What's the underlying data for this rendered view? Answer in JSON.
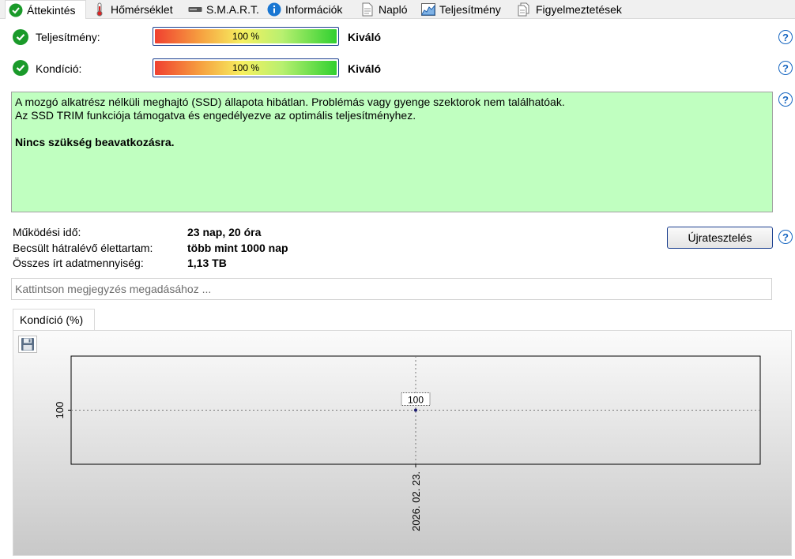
{
  "tabs": [
    {
      "label": "Áttekintés",
      "icon": "check-circle-icon",
      "active": true
    },
    {
      "label": "Hőmérséklet",
      "icon": "thermometer-icon",
      "active": false
    },
    {
      "label": "S.M.A.R.T.",
      "icon": "drive-icon",
      "active": false
    },
    {
      "label": "Információk",
      "icon": "info-icon",
      "active": false
    },
    {
      "label": "Napló",
      "icon": "document-icon",
      "active": false
    },
    {
      "label": "Teljesítmény",
      "icon": "performance-chart-icon",
      "active": false
    },
    {
      "label": "Figyelmeztetések",
      "icon": "warnings-icon",
      "active": false
    }
  ],
  "performance": {
    "label": "Teljesítmény:",
    "value": 1.0,
    "percent_text": "100 %",
    "rating": "Kiváló"
  },
  "condition": {
    "label": "Kondíció:",
    "value": 1.0,
    "percent_text": "100 %",
    "rating": "Kiváló"
  },
  "info": {
    "line1": "A mozgó alkatrész nélküli meghajtó (SSD) állapota hibátlan. Problémás vagy gyenge szektorok nem találhatóak.",
    "line2": "Az SSD TRIM funkciója támogatva és engedélyezve az optimális teljesítményhez.",
    "line3": "Nincs szükség beavatkozásra."
  },
  "stats": {
    "uptime_label": "Működési idő:",
    "uptime_value": "23 nap, 20 óra",
    "lifetime_label": "Becsült hátralévő élettartam:",
    "lifetime_value": "több mint 1000 nap",
    "written_label": "Összes írt adatmennyiség:",
    "written_value": "1,13 TB"
  },
  "retest_button": "Újratesztelés",
  "note_placeholder": "Kattintson megjegyzés megadásához ...",
  "chart_tab": "Kondíció  (%)",
  "chart_data": {
    "type": "line",
    "x": [
      "2026. 02. 23."
    ],
    "series": [
      {
        "values": [
          100
        ]
      }
    ],
    "yticks": [
      "100"
    ],
    "xticks": [
      "2026. 02. 23."
    ],
    "data_labels": [
      "100"
    ],
    "grid": true
  },
  "colors": {
    "ok_green": "#1a9a2a",
    "info_bg": "#c0ffc0",
    "help_blue": "#1565c0",
    "border_blue": "#1b3f8f"
  }
}
